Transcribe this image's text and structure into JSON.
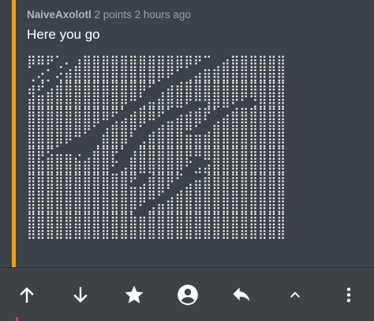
{
  "comment": {
    "author": "NaiveAxolotl",
    "points": "2 points",
    "age": "2 hours ago",
    "text": "Here you go",
    "ascii_art": "⡿⠿⠟⢁⠄⣰⣿⣿⣿⣿⣿⣿⣿⣿⣿⣿⣿⡿⠟⠉⢀⣴⣿⣿⣿⣿⣿⣿\n⢀⢔⡁⢔⣾⣿⣿⣿⣿⣿⣿⣿⣿⣿⡿⠟⠁⢀⣴⣿⣿⣿⣿⣿⣿⣿⣿⣿\n⣴⠞⣠⣾⣿⣿⣿⣿⣿⣿⣿⣿⡿⠋⢀⣴⣾⣿⣿⣿⣿⣿⣿⣿⣿⣿⣿⣿\n⣾⣿⣿⣿⣿⣿⣿⣿⣿⣿⡿⠛⢁⣤⣾⣿⣿⠟⠛⢻⣿⣿⠟⠋⢙⣿⣿⣿\n⣿⣿⣿⣿⣿⣿⣿⣿⣿⠟⢁⣴⣿⣿⠟⠁⣠⣴⣾⡟⠁⣠⣾⣿⣿⣿⣿⣿\n⣿⣿⣿⣿⣿⣿⡿⠋⢠⣾⣿⡿⠋⢀⣴⣿⣿⠿⠋⢀⣾⣿⣿⣿⣿⣿⣿⣿\n⣿⣿⣿⡿⠟⠉⠀⢀⣿⣿⡿⠁⣠⣿⣿⣿⣿⣿⣿⣿⣿⣿⣿⣿⣿⣿⣿⣿\n⣿⡿⣫⣤⣤⡠⢀⣾⣿⡟⠁⣰⣿⣿⣿⣿⣿⡿⠿⣿⣿⣿⣿⣿⣿⣿⣿⣿\n⣿⣿⣿⣿⣿⣿⣿⣿⣿⠋⣠⣿⣿⣿⣿⣿⡿⠋⣠⣴⣿⣿⣿⣿⣿⣿⣿⣿\n⣿⣿⣿⣿⣿⣿⣿⣿⣿⣿⣿⠟⢀⣾⣿⡿⠋⢀⣤⣾⣿⣿⣿⣿⣿⣿⣿⣿\n⣿⣿⣿⣿⣿⣿⣿⣿⣿⣿⣿⣿⣿⣿⠟⢁⣴⣿⣿⣿⣿⣿⣿⣿⣿⣿⣿⣿\n⣿⣿⣿⣿⣿⣿⣿⣿⣿⣿⣿⡿⠋⣠⣶⣿⣿⣿⣿⣿⣿⣿⣿⣿⣿⣿⣿⣿\n⣿⣿⣿⣿⣿⣿⣿⣿⣿⣿⣿⣷⣶⣿⣿⣿⣿⣿⣿⣿⣿⣿⣿⣿⣿⣿⣿⣿\n⣿⣿⣿⣿⣿⣿⣿⣿⣿⣿⣿⣿⣿⣿⣿⣿⣿⣿⣿⣿⣿⣿⣿⣿⣿⣿⣿⣿",
    "accent_color": "#f39c12"
  },
  "toolbar": {
    "buttons": [
      {
        "name": "upvote-button",
        "icon": "arrow-up-icon"
      },
      {
        "name": "downvote-button",
        "icon": "arrow-down-icon"
      },
      {
        "name": "save-button",
        "icon": "star-icon"
      },
      {
        "name": "profile-button",
        "icon": "account-circle-icon"
      },
      {
        "name": "reply-button",
        "icon": "reply-icon"
      },
      {
        "name": "collapse-button",
        "icon": "chevron-up-icon"
      },
      {
        "name": "more-options-button",
        "icon": "more-vertical-icon"
      }
    ],
    "icon_color": "#ffffff"
  }
}
